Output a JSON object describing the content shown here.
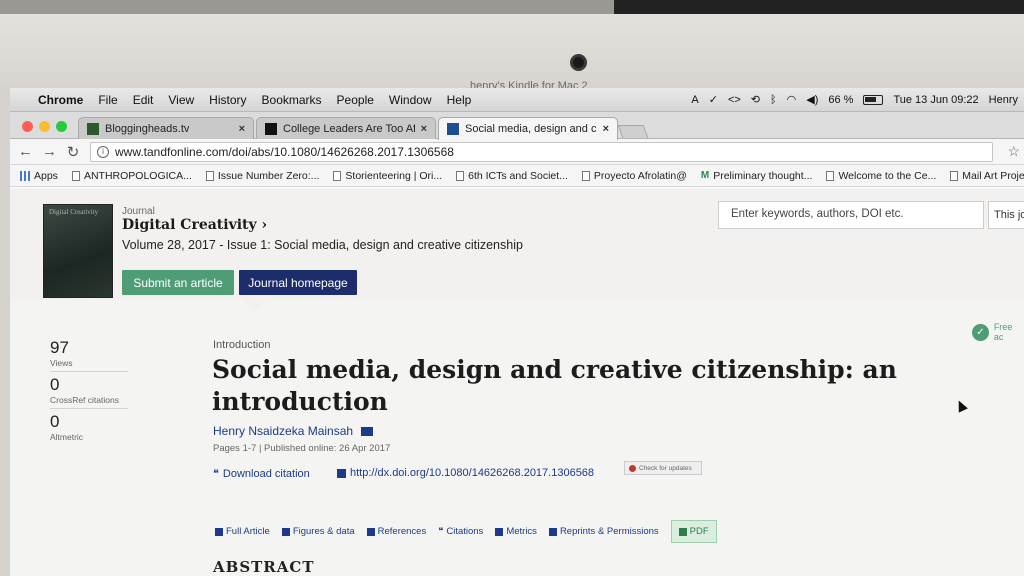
{
  "window_title": "henry's Kindle for Mac 2",
  "menubar": {
    "items": [
      "Chrome",
      "File",
      "Edit",
      "View",
      "History",
      "Bookmarks",
      "People",
      "Window",
      "Help"
    ],
    "battery": "66 %",
    "datetime": "Tue 13 Jun  09:22",
    "user": "Henry"
  },
  "tabs": [
    {
      "title": "Bloggingheads.tv",
      "close": "×"
    },
    {
      "title": "College Leaders Are Too Afraid",
      "close": "×"
    },
    {
      "title": "Social media, design and creat",
      "close": "×"
    }
  ],
  "address": {
    "url": "www.tandfonline.com/doi/abs/10.1080/14626268.2017.1306568"
  },
  "bookmarks": [
    "Apps",
    "ANTHROPOLOGICA...",
    "Issue Number Zero:...",
    "Storienteering | Ori...",
    "6th ICTs and Societ...",
    "Proyecto Afrolatin@",
    "Preliminary thought...",
    "Welcome to the Ce...",
    "Mail Art Project Bac..."
  ],
  "journal": {
    "label": "Journal",
    "title": "Digital Creativity ›",
    "cover_text": "Digital Creativity",
    "volume": "Volume 28, 2017 - Issue 1: Social media, design and creative citizenship",
    "submit": "Submit an article",
    "homepage": "Journal homepage",
    "search_placeholder": "Enter keywords, authors, DOI etc.",
    "this_journal": "This jo"
  },
  "metrics": [
    {
      "value": "97",
      "label": "Views"
    },
    {
      "value": "0",
      "label": "CrossRef citations"
    },
    {
      "value": "0",
      "label": "Altmetric"
    }
  ],
  "article": {
    "kicker": "Introduction",
    "title": "Social media, design and creative citizenship: an introduction",
    "author": "Henry Nsaidzeka Mainsah",
    "pub_info": "Pages 1-7 | Published online: 26 Apr 2017",
    "download": "Download citation",
    "doi": "http://dx.doi.org/10.1080/14626268.2017.1306568",
    "check_updates": "Check for updates",
    "free_access": "Free ac",
    "abstract_heading": "ABSTRACT"
  },
  "article_tabs": [
    "Full Article",
    "Figures & data",
    "References",
    "Citations",
    "Metrics",
    "Reprints & Permissions",
    "PDF"
  ],
  "colors": {
    "submit_green": "#4e9d77",
    "homepage_navy": "#1d2c6b",
    "link_blue": "#1d3a8a"
  }
}
